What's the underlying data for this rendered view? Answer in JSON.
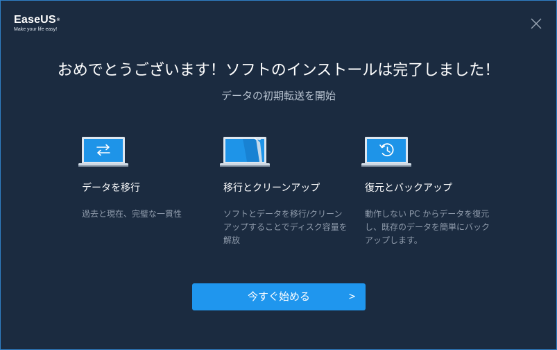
{
  "brand": {
    "name": "EaseUS",
    "reg": "®",
    "tagline": "Make your life easy!"
  },
  "header": {
    "title": "おめでとうございます！ソフトのインストールは完了しました！",
    "subtitle": "データの初期転送を開始"
  },
  "features": [
    {
      "icon": "data-transfer-laptop-icon",
      "title": "データを移行",
      "description": "過去と現在、完璧な一貫性"
    },
    {
      "icon": "cleanup-laptop-icon",
      "title": "移行とクリーンアップ",
      "description": "ソフトとデータを移行/クリーンアップすることでディスク容量を解放"
    },
    {
      "icon": "restore-backup-laptop-icon",
      "title": "復元とバックアップ",
      "description": "動作しない PC からデータを復元し、既存のデータを簡単にバックアップします。"
    }
  ],
  "actions": {
    "start_label": "今すぐ始める",
    "start_chevron": ">"
  },
  "colors": {
    "background": "#1b2b40",
    "accent": "#1f96ee",
    "border": "#2f80c6"
  }
}
